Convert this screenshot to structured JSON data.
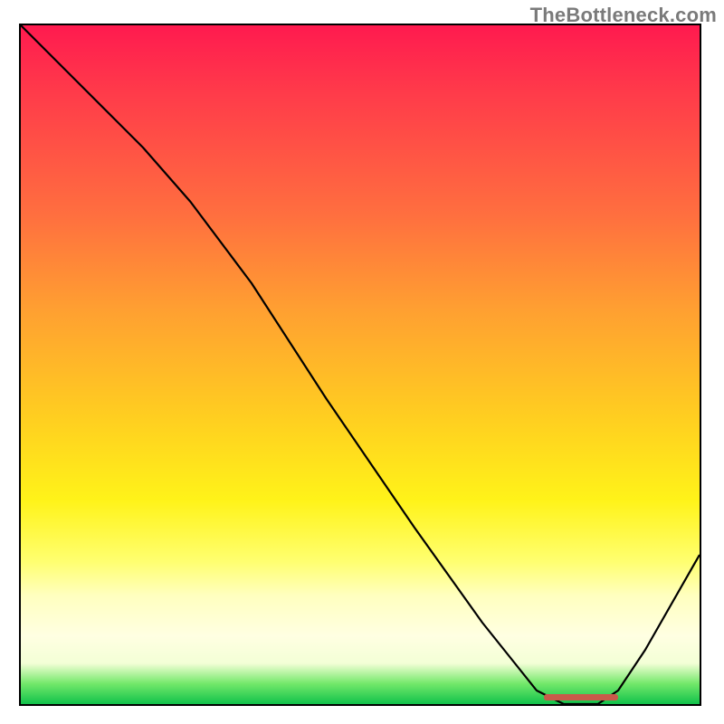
{
  "attribution": "TheBottleneck.com",
  "colors": {
    "line": "#000000",
    "marker": "#c95a4a"
  },
  "chart_data": {
    "type": "line",
    "title": "",
    "xlabel": "",
    "ylabel": "",
    "xlim": [
      0,
      100
    ],
    "ylim": [
      0,
      100
    ],
    "grid": false,
    "legend": false,
    "series": [
      {
        "name": "curve",
        "x": [
          0,
          8,
          18,
          25,
          34,
          45,
          58,
          68,
          76,
          80,
          85,
          88,
          92,
          100
        ],
        "values": [
          100,
          92,
          82,
          74,
          62,
          45,
          26,
          12,
          2,
          0,
          0,
          2,
          8,
          22
        ]
      }
    ],
    "marker": {
      "x_start": 77,
      "x_end": 88,
      "y": 1
    }
  }
}
